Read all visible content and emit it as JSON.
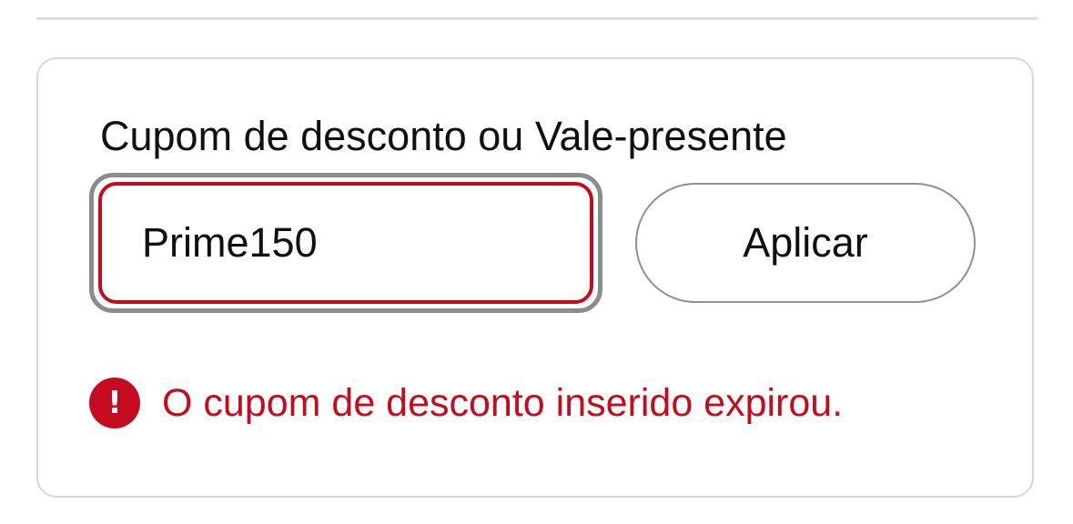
{
  "coupon_section": {
    "label": "Cupom de desconto ou Vale-presente",
    "input_value": "Prime150",
    "apply_label": "Aplicar",
    "error_icon": "exclamation-circle-icon",
    "error_message": "O cupom de desconto inserido expirou."
  },
  "colors": {
    "error": "#c40c1e",
    "text": "#0f1111",
    "border": "#d5d9d9",
    "focus_ring": "#8a8d8e"
  }
}
